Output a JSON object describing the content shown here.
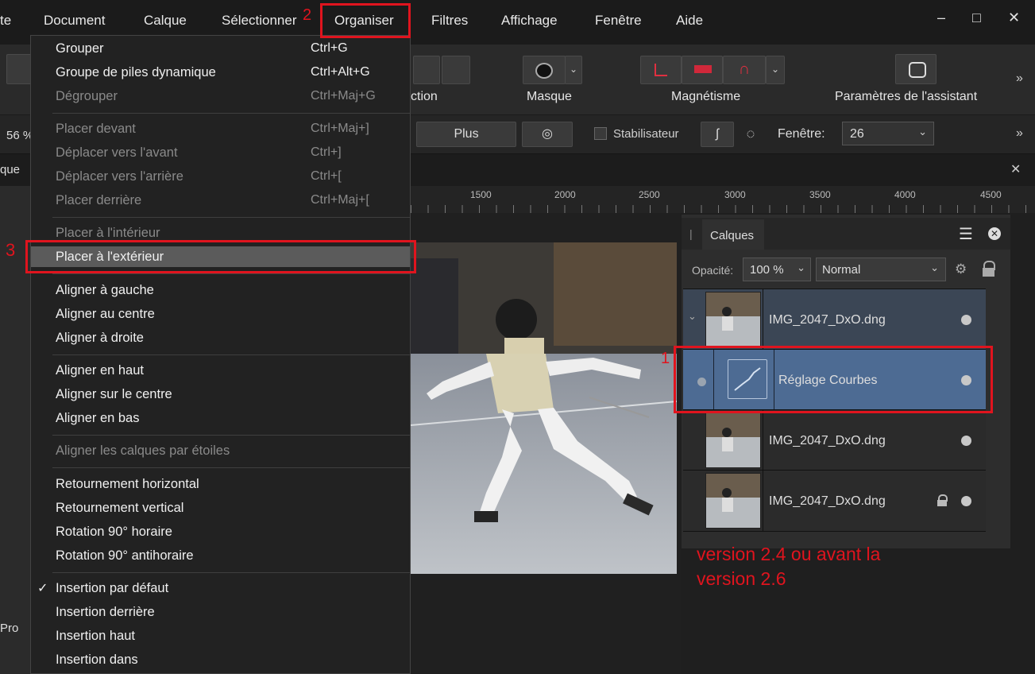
{
  "menubar": {
    "items": [
      "te",
      "Document",
      "Calque",
      "Sélectionner",
      "Organiser",
      "Filtres",
      "Affichage",
      "Fenêtre",
      "Aide"
    ],
    "window_controls": [
      "–",
      "□",
      "✕"
    ]
  },
  "toolbar": {
    "masque_label": "Masque",
    "magnetisme_label": "Magnétisme",
    "assistant_label": "Paramètres de l'assistant",
    "partial_label": "ction",
    "more": "»"
  },
  "contextbar": {
    "zoom": "56 %",
    "plus_label": "Plus",
    "stabilisateur_label": "Stabilisateur",
    "fenetre_label": "Fenêtre:",
    "fenetre_value": "26",
    "more": "»"
  },
  "tabbar": {
    "partial": "que",
    "close": "✕"
  },
  "ruler": {
    "ticks": [
      "1500",
      "2000",
      "2500",
      "3000",
      "3500",
      "4000",
      "4500"
    ]
  },
  "leftpanel": {
    "partial": "Pro"
  },
  "organiser_menu": {
    "items": [
      {
        "label": "Grouper",
        "shortcut": "Ctrl+G",
        "enabled": true
      },
      {
        "label": "Groupe de piles dynamique",
        "shortcut": "Ctrl+Alt+G",
        "enabled": true
      },
      {
        "label": "Dégrouper",
        "shortcut": "Ctrl+Maj+G",
        "enabled": false
      },
      {
        "label": "Placer devant",
        "shortcut": "Ctrl+Maj+]",
        "enabled": false
      },
      {
        "label": "Déplacer vers l'avant",
        "shortcut": "Ctrl+]",
        "enabled": false
      },
      {
        "label": "Déplacer vers l'arrière",
        "shortcut": "Ctrl+[",
        "enabled": false
      },
      {
        "label": "Placer derrière",
        "shortcut": "Ctrl+Maj+[",
        "enabled": false
      },
      {
        "label": "Placer à l'intérieur",
        "shortcut": "",
        "enabled": false
      },
      {
        "label": "Placer à l'extérieur",
        "shortcut": "",
        "enabled": true
      },
      {
        "label": "Aligner à gauche",
        "shortcut": "",
        "enabled": true
      },
      {
        "label": "Aligner au centre",
        "shortcut": "",
        "enabled": true
      },
      {
        "label": "Aligner à droite",
        "shortcut": "",
        "enabled": true
      },
      {
        "label": "Aligner en haut",
        "shortcut": "",
        "enabled": true
      },
      {
        "label": "Aligner sur le centre",
        "shortcut": "",
        "enabled": true
      },
      {
        "label": "Aligner en bas",
        "shortcut": "",
        "enabled": true
      },
      {
        "label": "Aligner les calques par étoiles",
        "shortcut": "",
        "enabled": false
      },
      {
        "label": "Retournement horizontal",
        "shortcut": "",
        "enabled": true
      },
      {
        "label": "Retournement vertical",
        "shortcut": "",
        "enabled": true
      },
      {
        "label": "Rotation 90° horaire",
        "shortcut": "",
        "enabled": true
      },
      {
        "label": "Rotation 90° antihoraire",
        "shortcut": "",
        "enabled": true
      },
      {
        "label": "Insertion par défaut",
        "shortcut": "",
        "enabled": true,
        "checked": true
      },
      {
        "label": "Insertion derrière",
        "shortcut": "",
        "enabled": true
      },
      {
        "label": "Insertion haut",
        "shortcut": "",
        "enabled": true
      },
      {
        "label": "Insertion dans",
        "shortcut": "",
        "enabled": true
      }
    ],
    "checkmark": "✓"
  },
  "layers_panel": {
    "title": "Calques",
    "opacity_label": "Opacité:",
    "opacity_value": "100 %",
    "blend_mode": "Normal",
    "layers": [
      {
        "name": "IMG_2047_DxO.dng"
      },
      {
        "name": "Réglage Courbes"
      },
      {
        "name": "IMG_2047_DxO.dng"
      },
      {
        "name": "IMG_2047_DxO.dng"
      }
    ]
  },
  "annotations": {
    "step1": "1",
    "step2": "2",
    "step3": "3",
    "note_line1": "version 2.4 ou avant la",
    "note_line2": "version 2.6",
    "accent": "#e0141e"
  }
}
